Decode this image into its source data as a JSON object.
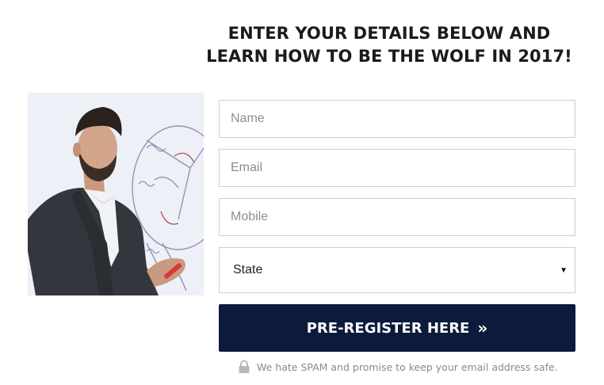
{
  "heading": {
    "line1": "ENTER YOUR DETAILS BELOW AND",
    "line2": "LEARN HOW TO BE THE WOLF IN 2017!"
  },
  "form": {
    "name_placeholder": "Name",
    "email_placeholder": "Email",
    "mobile_placeholder": "Mobile",
    "state_selected": "State",
    "submit_label": "PRE-REGISTER HERE",
    "submit_icon": "double-chevron-right-icon",
    "spam_note": "We hate SPAM and promise to keep your email address safe.",
    "spam_icon": "lock-icon"
  },
  "colors": {
    "button_bg": "#0c1a3c",
    "border": "#cfcfcf",
    "note_text": "#8a8a8a"
  }
}
